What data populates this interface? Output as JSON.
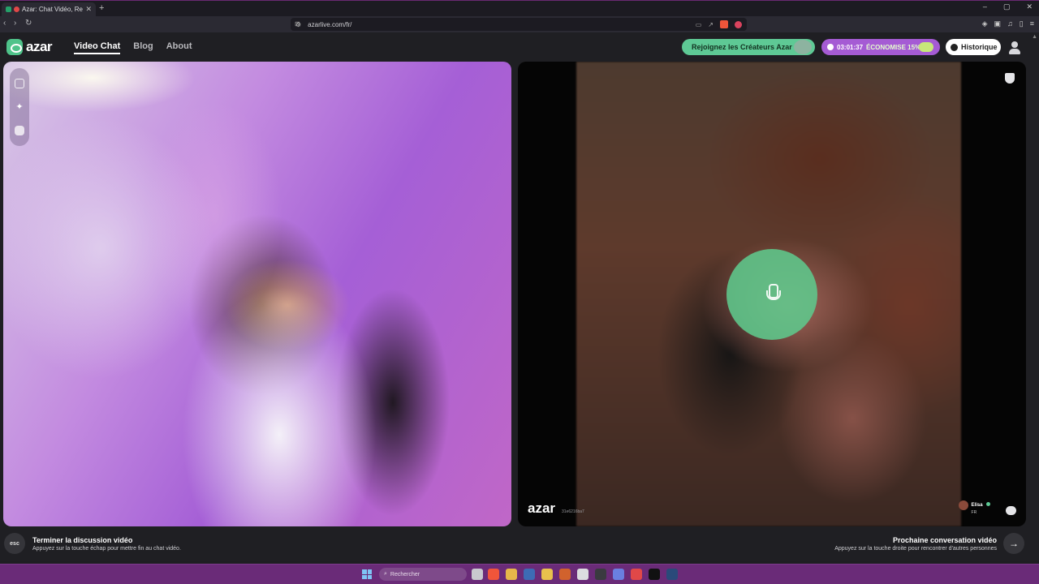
{
  "browser": {
    "tab_title": "Azar: Chat Vidéo, Rencontre",
    "new_tab": "+",
    "url": "azarlive.com/fr/",
    "window_controls": [
      "–",
      "▢",
      "✕"
    ]
  },
  "header": {
    "logo_text": "azar",
    "nav": [
      {
        "label": "Video Chat",
        "active": true
      },
      {
        "label": "Blog",
        "active": false
      },
      {
        "label": "About",
        "active": false
      }
    ],
    "creators_button": "Rejoignez les Créateurs Azar",
    "timer_value": "03:01:37",
    "timer_promo": "ÉCONOMISE 15%",
    "history_button": "Historique"
  },
  "peer": {
    "watermark_logo": "azar",
    "watermark_id": "31e6216ba7",
    "name": "Elisa",
    "country": "FR"
  },
  "bottom": {
    "esc_label": "esc",
    "end_title": "Terminer la discussion vidéo",
    "end_hint": "Appuyez sur la touche échap pour mettre fin au chat vidéo.",
    "next_title": "Prochaine conversation vidéo",
    "next_hint": "Appuyez sur la touche droite pour rencontrer d'autres personnes",
    "next_arrow": "→"
  },
  "taskbar": {
    "search_placeholder": "Rechercher"
  },
  "colors": {
    "accent_green": "#5ec995",
    "timer_purple": "#a55bd4",
    "taskbar": "#6a2b78"
  }
}
